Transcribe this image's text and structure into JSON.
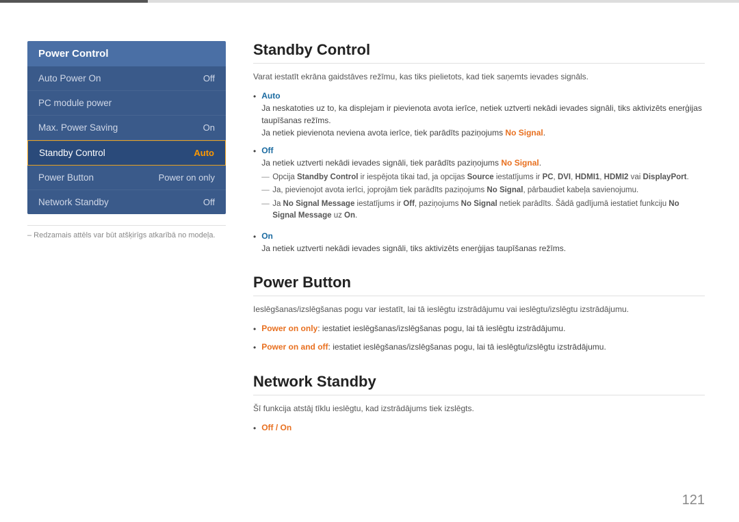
{
  "topLine": true,
  "sidebar": {
    "header": "Power Control",
    "items": [
      {
        "label": "Auto Power On",
        "value": "Off",
        "active": false
      },
      {
        "label": "PC module power",
        "value": "",
        "active": false
      },
      {
        "label": "Max. Power Saving",
        "value": "On",
        "active": false
      },
      {
        "label": "Standby Control",
        "value": "Auto",
        "active": true
      },
      {
        "label": "Power Button",
        "value": "Power on only",
        "active": false
      },
      {
        "label": "Network Standby",
        "value": "Off",
        "active": false
      }
    ]
  },
  "footnote": "– Redzamais attēls var būt atšķirīgs atkarībā no modeļa.",
  "sections": {
    "standbyControl": {
      "title": "Standby Control",
      "desc": "Varat iestatīt ekrāna gaidstāves režīmu, kas tiks pielietots, kad tiek saņemts ievades signāls.",
      "bullets": [
        {
          "term": "Auto",
          "termType": "blue",
          "content": "Ja neskatoties uz to, ka displejam ir pievienota avota ierīce, netiek uztverti nekādi ievades signāli, tiks aktivizēts enerģijas taupīšanas režīms.",
          "subContent": "Ja netiek pievienota neviena avota ierīce, tiek parādīts paziņojums No Signal."
        },
        {
          "term": "Off",
          "termType": "blue",
          "content": "Ja netiek uztverti nekādi ievades signāli, tiek parādīts paziņojums No Signal.",
          "subItems": [
            "Opcija Standby Control ir iespējota tikai tad, ja opcijas Source iestatījums ir PC, DVI, HDMI1, HDMI2 vai DisplayPort.",
            "Ja, pievienojot avota ierīci, joprojām tiek parādīts paziņojums No Signal, pārbaudiet kabeļa savienojumu.",
            "Ja No Signal Message iestatījums ir Off, paziņojums No Signal netiek parādīts. Šādā gadījumā iestatiet funkciju No Signal Message uz On."
          ]
        },
        {
          "term": "On",
          "termType": "blue",
          "content": "Ja netiek uztverti nekādi ievades signāli, tiks aktivizēts enerģijas taupīšanas režīms."
        }
      ]
    },
    "powerButton": {
      "title": "Power Button",
      "desc": "Ieslēgšanas/izslēgšanas pogu var iestatīt, lai tā ieslēgtu izstrādājumu vai ieslēgtu/izslēgtu izstrādājumu.",
      "bullets": [
        {
          "term": "Power on only",
          "termType": "orange",
          "content": ": iestatiet ieslēgšanas/izslēgšanas pogu, lai tā ieslēgtu izstrādājumu."
        },
        {
          "term": "Power on and off",
          "termType": "orange",
          "content": ": iestatiet ieslēgšanas/izslēgšanas pogu, lai tā ieslēgtu/izslēgtu izstrādājumu."
        }
      ]
    },
    "networkStandby": {
      "title": "Network Standby",
      "desc": "Šī funkcija atstāj tīklu ieslēgtu, kad izstrādājums tiek izslēgts.",
      "bullets": [
        {
          "term": "Off / On",
          "termType": "orange",
          "content": ""
        }
      ]
    }
  },
  "pageNumber": "121"
}
